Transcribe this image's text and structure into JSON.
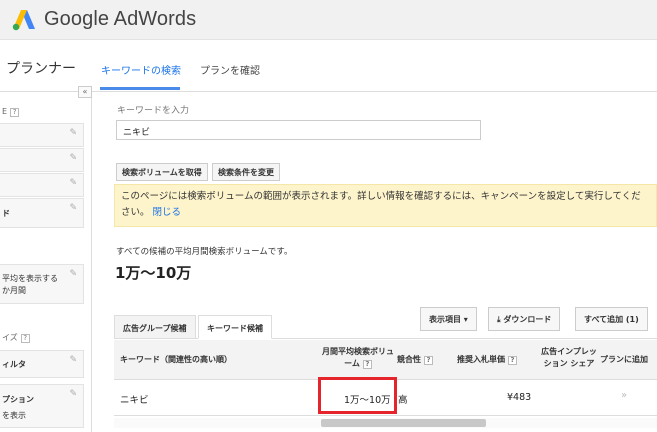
{
  "app": {
    "brand_name": "Google AdWords",
    "title": "プランナー"
  },
  "tabs": {
    "search": "キーワードの検索",
    "review": "プランを確認"
  },
  "sidebar": {
    "collapse": "«",
    "section1_label": "E",
    "row4_label": "ド",
    "row5_label": "平均を表示する\nか月間",
    "section2_label": "イズ",
    "row6_label": "ィルタ",
    "row7_label": "プション",
    "row7_sub": "を表示"
  },
  "keyword": {
    "label": "キーワードを入力",
    "value": "ニキビ"
  },
  "buttons": {
    "get_volume": "検索ボリュームを取得",
    "change_criteria": "検索条件を変更"
  },
  "notice": {
    "text": "このページには検索ボリュームの範囲が表示されます。詳しい情報を確認するには、キャンペーンを設定して実行してください。",
    "close": "閉じる"
  },
  "summary": {
    "label": "すべての候補の平均月間検索ボリュームです。",
    "value": "1万〜10万"
  },
  "result_tabs": {
    "ad_group": "広告グループ候補",
    "keyword": "キーワード候補"
  },
  "tools": {
    "columns": "表示項目 ▾",
    "download": "⤓ ダウンロード",
    "add_all": "すべて追加 (1)"
  },
  "table": {
    "headers": {
      "keyword": "キーワード（関連性の高い順）",
      "volume": "月間平均検索ボリューム",
      "competition": "競合性",
      "bid": "推奨入札単価",
      "impression_share": "広告インプレッション シェア",
      "add": "プランに追加"
    },
    "rows": [
      {
        "keyword": "ニキビ",
        "volume": "1万〜10万",
        "competition": "高",
        "bid": "¥483",
        "add": "»"
      }
    ]
  },
  "help_marker": "?"
}
